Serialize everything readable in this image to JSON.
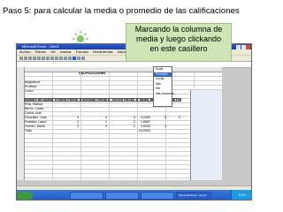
{
  "slide": {
    "title": "Paso 5: para calcular la media o promedio de las calificaciones",
    "callout_lines": [
      "Marcando la columna de",
      "media y luego clickando",
      "en este casillero"
    ]
  },
  "window": {
    "title": "Microsoft Excel - Libro1"
  },
  "menu": [
    "Archivo",
    "Edición",
    "Ver",
    "Insertar",
    "Formato",
    "Herramientas",
    "Datos",
    "Ventana",
    "?"
  ],
  "dropdown": {
    "items": [
      "Suma",
      "Promedio",
      "Contar",
      "Máx",
      "Mín",
      "Más funciones..."
    ],
    "selected": 1
  },
  "sheet": {
    "title_cell": "CALIFICACIONES",
    "info_rows": [
      "Asignatura",
      "Profesor",
      "Curso"
    ],
    "headers": [
      "Nombre del alumno",
      "Primera Parcial",
      "Segunda Parcial",
      "Tercera Parcial",
      "Media",
      "Examen Final",
      "Nota Final"
    ],
    "students": [
      {
        "name": "Ruiz, Blanca",
        "p1": "",
        "p2": "",
        "p3": "",
        "media": "",
        "final": "",
        "nota": ""
      },
      {
        "name": "Berrio, Lucas",
        "p1": "",
        "p2": "",
        "p3": "",
        "media": "",
        "final": "",
        "nota": ""
      },
      {
        "name": "Carlos, Ana",
        "p1": "",
        "p2": "",
        "p3": "",
        "media": "",
        "final": "",
        "nota": ""
      },
      {
        "name": "González, Juan",
        "p1": "3",
        "p2": "4",
        "p3": "5",
        "media": "4,0000",
        "final": "3",
        "nota": "3"
      },
      {
        "name": "Rosales, Laura",
        "p1": "2",
        "p2": "1",
        "p3": "2",
        "media": "1,6667",
        "final": "",
        "nota": ""
      },
      {
        "name": "Gómez, María",
        "p1": "3",
        "p2": "4",
        "p3": "2",
        "media": "3,0000",
        "final": "4",
        "nota": ""
      }
    ],
    "total_label": "Total",
    "total_value": "24,0000"
  },
  "taskbar": {
    "clock": "10:41"
  }
}
